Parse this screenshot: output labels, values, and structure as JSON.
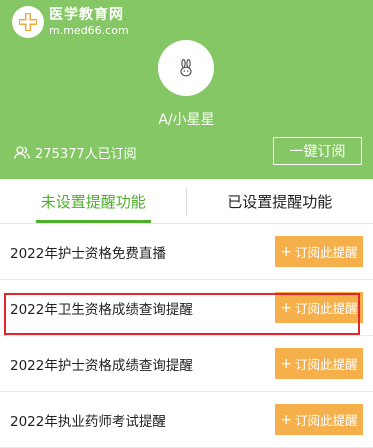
{
  "header": {
    "logo_name": "医学教育网",
    "logo_url": "m.med66.com",
    "username": "A/小星星",
    "subscribers_text": "275377人已订阅",
    "one_click_label": "一键订阅"
  },
  "tabs": [
    {
      "label": "未设置提醒功能",
      "active": true
    },
    {
      "label": "已设置提醒功能",
      "active": false
    }
  ],
  "reminders": [
    {
      "title": "2022年护士资格免费直播",
      "button": "订阅此提醒"
    },
    {
      "title": "2022年卫生资格成绩查询提醒",
      "button": "订阅此提醒",
      "highlighted": true
    },
    {
      "title": "2022年护士资格成绩查询提醒",
      "button": "订阅此提醒"
    },
    {
      "title": "2022年执业药师考试提醒",
      "button": "订阅此提醒"
    }
  ],
  "colors": {
    "header_bg": "#85c765",
    "active_tab": "#4fae2b",
    "button_bg": "#f5b04b",
    "highlight_border": "#e3262b"
  }
}
